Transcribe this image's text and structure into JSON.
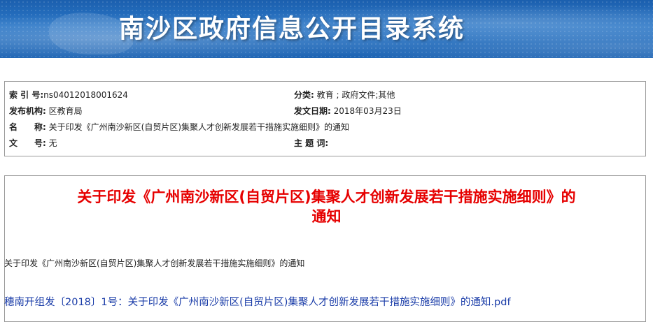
{
  "header": {
    "title": "南沙区政府信息公开目录系统",
    "bg_color": "#1c63b3"
  },
  "meta": {
    "index_label": "索 引 号:",
    "index_value": "ns04012018001624",
    "category_label": "分类:",
    "category_value": "教育 ; 政府文件;其他",
    "publisher_label": "发布机构:",
    "publisher_value": "区教育局",
    "date_label": "发文日期:",
    "date_value": "2018年03月23日",
    "name_label": "名　　称:",
    "name_value": "关于印发《广州南沙新区(自贸片区)集聚人才创新发展若干措施实施细则》的通知",
    "doc_no_label": "文　　号:",
    "doc_no_value": "无",
    "subject_label": "主 题 词:",
    "subject_value": ""
  },
  "document": {
    "title_line1": "关于印发《广州南沙新区(自贸片区)集聚人才创新发展若干措施实施细则》的",
    "title_line2": "通知",
    "body_line": "关于印发《广州南沙新区(自贸片区)集聚人才创新发展若干措施实施细则》的通知",
    "attachment_link": "穗南开组发〔2018〕1号：关于印发《广州南沙新区(自贸片区)集聚人才创新发展若干措施实施细则》的通知.pdf",
    "title_color": "#e60000",
    "link_color": "#1a3ca8"
  }
}
